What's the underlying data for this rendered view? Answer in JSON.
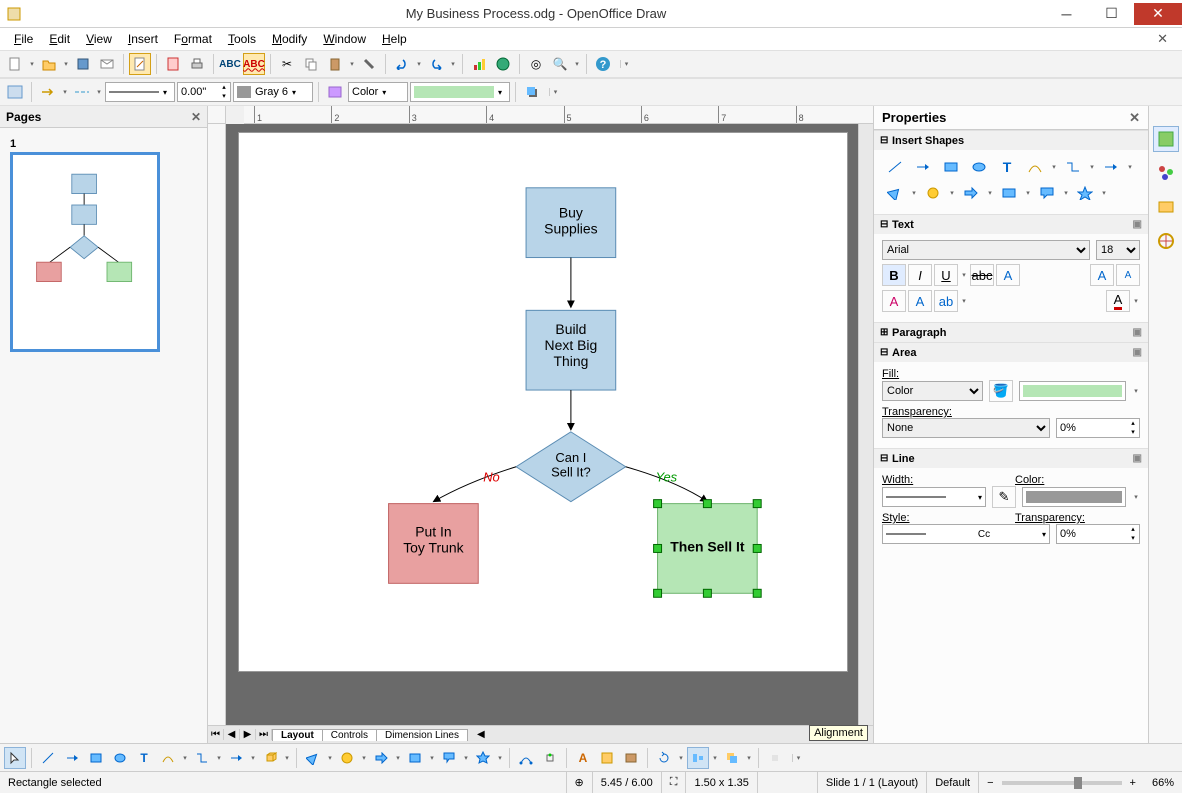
{
  "window": {
    "title": "My Business Process.odg - OpenOffice Draw"
  },
  "menu": [
    "File",
    "Edit",
    "View",
    "Insert",
    "Format",
    "Tools",
    "Modify",
    "Window",
    "Help"
  ],
  "toolbar2": {
    "line_width": "0.00\"",
    "line_color_label": "Gray 6",
    "area_type": "Color"
  },
  "pages_panel": {
    "title": "Pages",
    "page_number": "1"
  },
  "tabs": [
    "Layout",
    "Controls",
    "Dimension Lines"
  ],
  "tooltip": "Alignment",
  "flowchart": {
    "node1": "Buy\nSupplies",
    "node2": "Build\nNext Big\nThing",
    "decision": "Can I\nSell It?",
    "no_label": "No",
    "yes_label": "Yes",
    "left_end": "Put In\nToy Trunk",
    "right_end": "Then Sell It"
  },
  "properties": {
    "title": "Properties",
    "sections": {
      "insert_shapes": "Insert Shapes",
      "text": "Text",
      "paragraph": "Paragraph",
      "area": "Area",
      "line": "Line"
    },
    "font_name": "Arial",
    "font_size": "18",
    "fill_label": "Fill:",
    "fill_type": "Color",
    "transparency_label": "Transparency:",
    "transparency_type": "None",
    "transparency_value": "0%",
    "line_width_label": "Width:",
    "line_color_label": "Color:",
    "line_style_label": "Style:",
    "line_style_value": "Cc",
    "line_transparency_label": "Transparency:",
    "line_transparency_value": "0%"
  },
  "status": {
    "selection": "Rectangle selected",
    "pos": "5.45 / 6.00",
    "size": "1.50 x 1.35",
    "slide": "Slide 1 / 1 (Layout)",
    "style": "Default",
    "zoom": "66%"
  }
}
